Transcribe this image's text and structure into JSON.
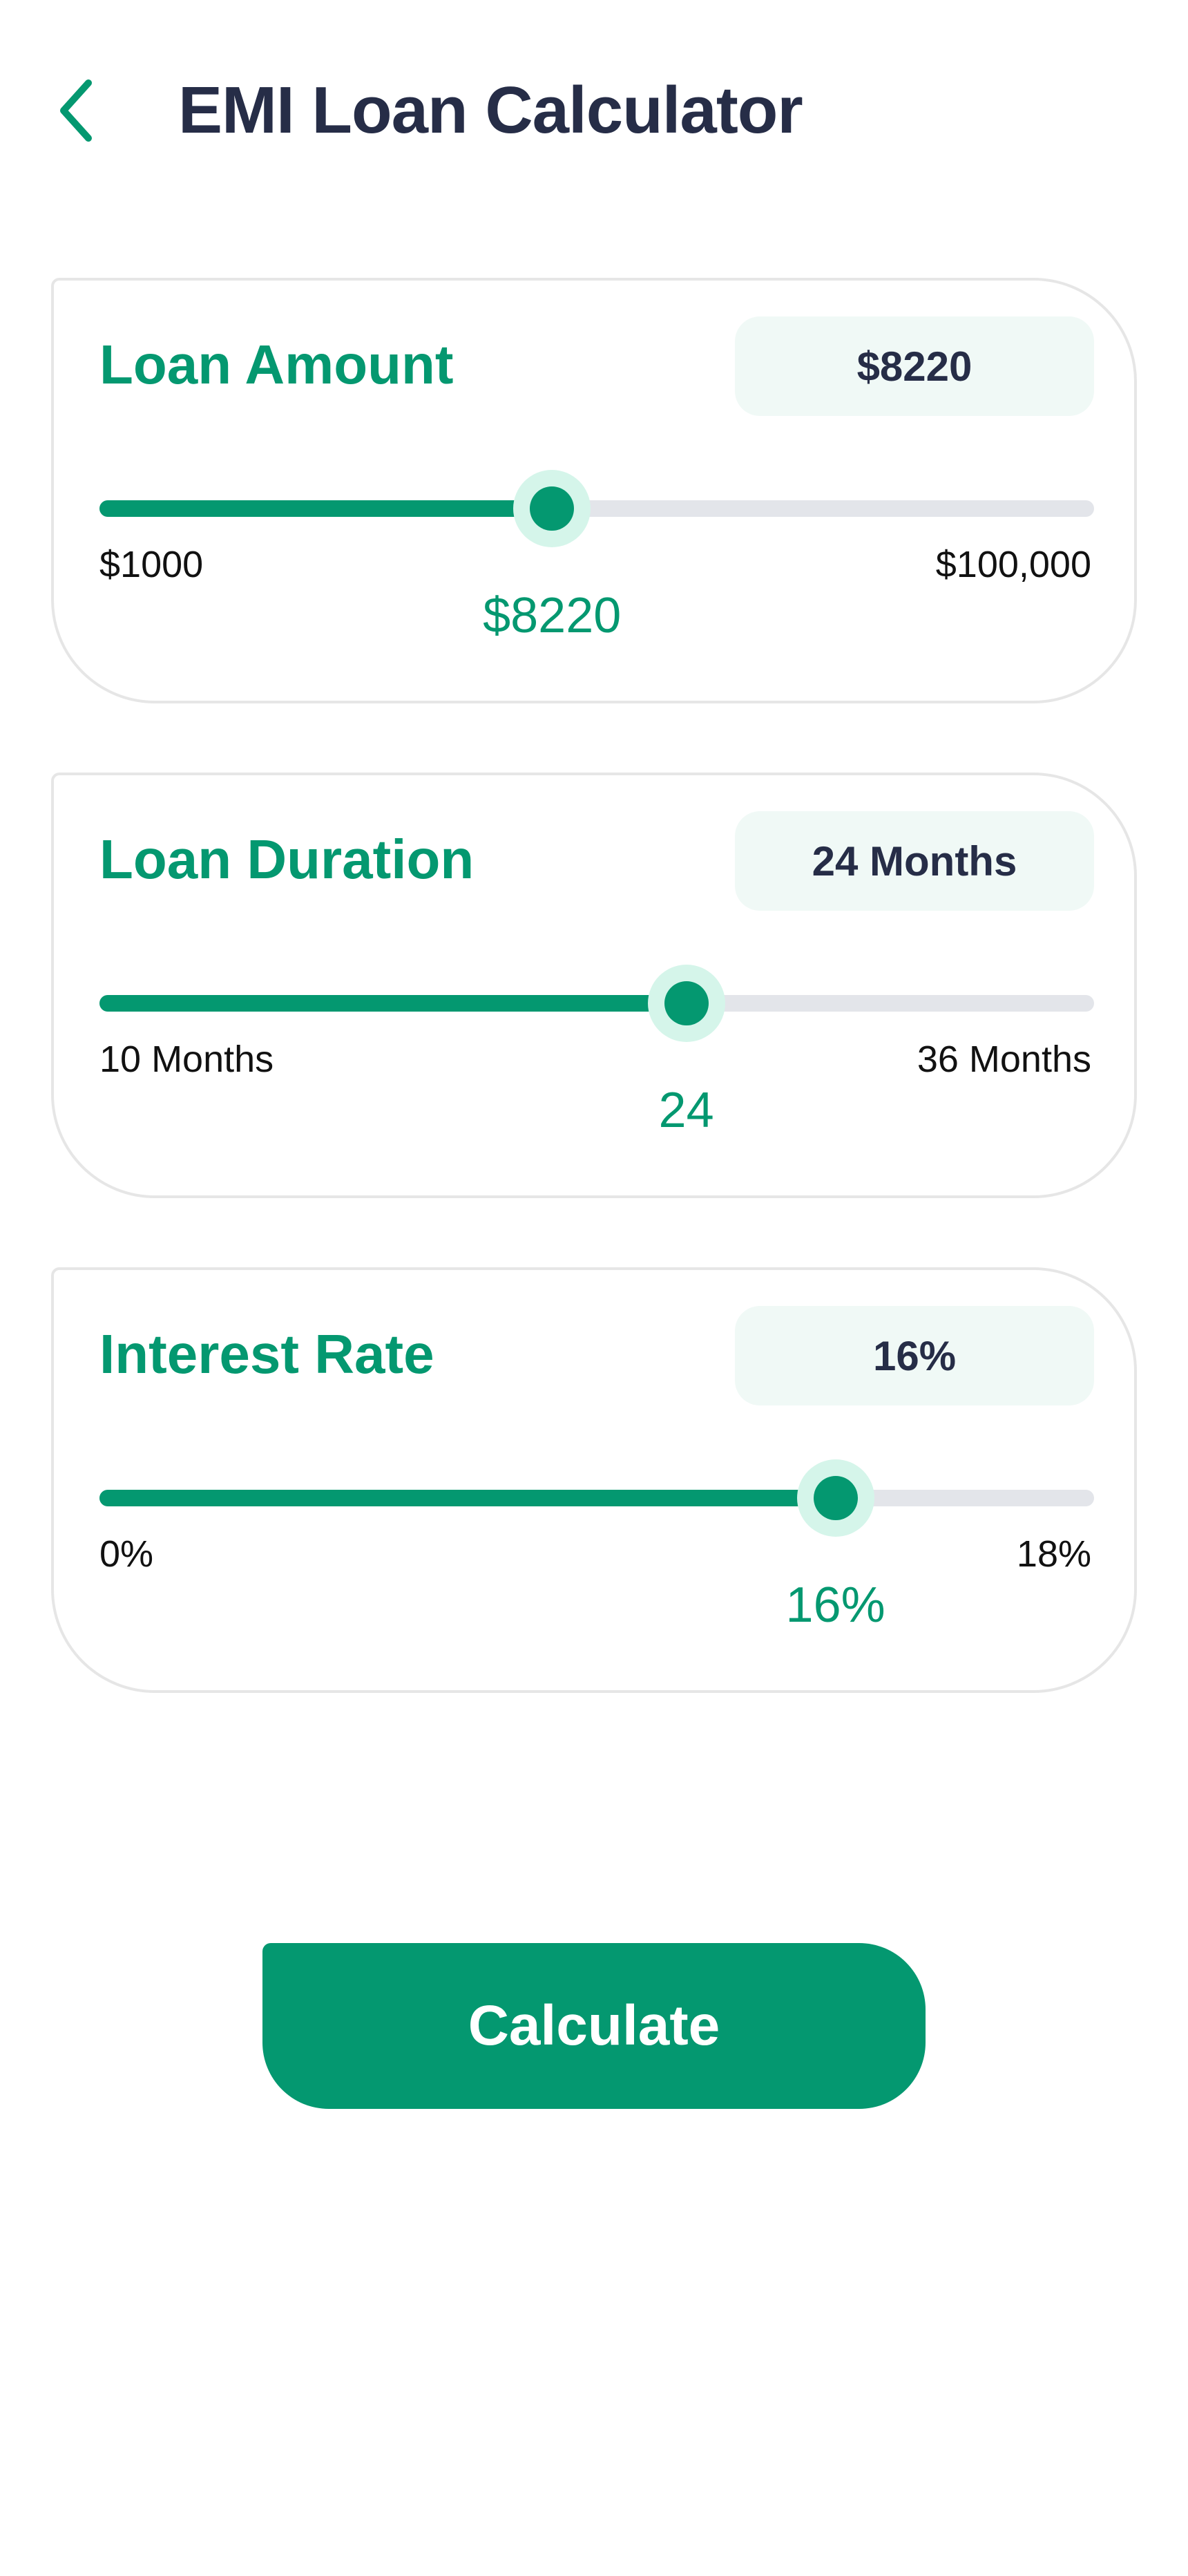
{
  "header": {
    "title": "EMI Loan Calculator",
    "back_icon": "chevron-left-icon"
  },
  "colors": {
    "accent": "#049870",
    "accent_light": "#d5f5ea",
    "badge_bg": "#f0f9f6",
    "title_text": "#262d47",
    "track_bg": "#e3e5ea"
  },
  "loan_amount": {
    "title": "Loan Amount",
    "badge": "$8220",
    "min_label": "$1000",
    "max_label": "$100,000",
    "current_label": "$8220",
    "fraction": 0.455
  },
  "loan_duration": {
    "title": "Loan Duration",
    "badge": "24 Months",
    "min_label": "10 Months",
    "max_label": "36 Months",
    "current_label": "24",
    "fraction": 0.59
  },
  "interest_rate": {
    "title": "Interest Rate",
    "badge": "16%",
    "min_label": "0%",
    "max_label": "18%",
    "current_label": "16%",
    "fraction": 0.74
  },
  "calculate_button": {
    "label": "Calculate"
  }
}
